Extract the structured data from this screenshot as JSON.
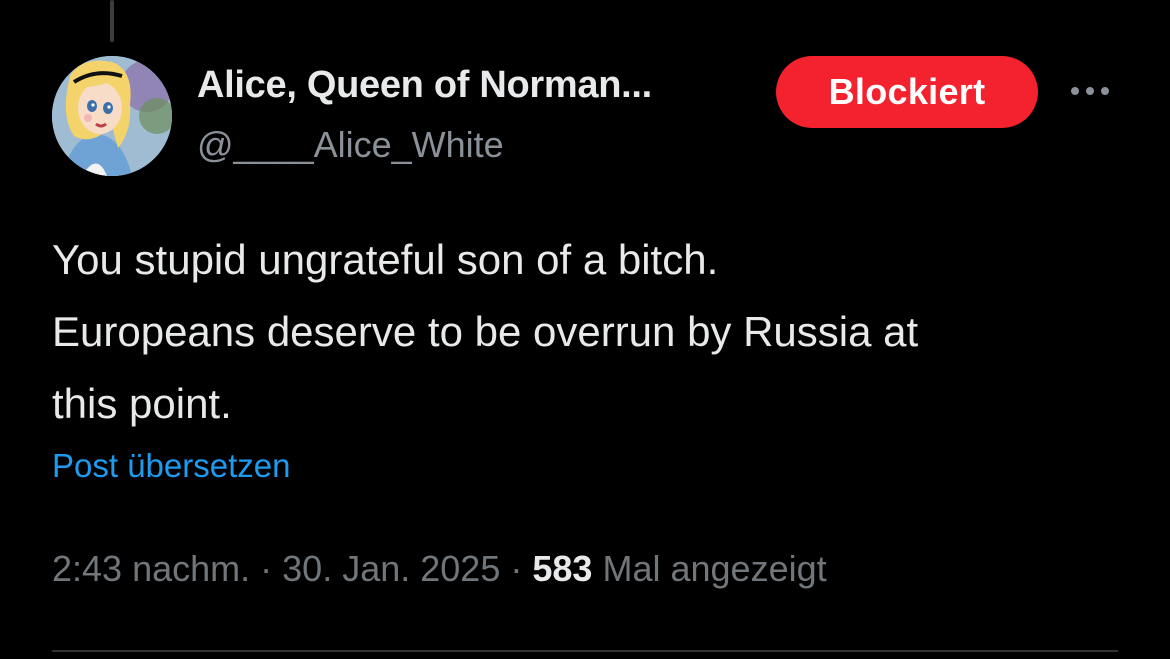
{
  "author": {
    "display_name": "Alice, Queen of Norman...",
    "handle": "@____Alice_White"
  },
  "actions": {
    "blocked_label": "Blockiert",
    "more_icon": "more-horizontal-icon"
  },
  "tweet": {
    "lines": [
      "You stupid ungrateful son of a bitch.",
      "Europeans deserve to be overrun by Russia at",
      "this point."
    ],
    "translate_label": "Post übersetzen"
  },
  "meta": {
    "time": "2:43 nachm.",
    "separator": "·",
    "date": "30. Jan. 2025",
    "views_count": "583",
    "views_label": "Mal angezeigt"
  },
  "colors": {
    "background": "#000000",
    "primary_text": "#e7e9ea",
    "secondary_text": "#71767b",
    "link": "#1d9bf0",
    "blocked": "#f4212e"
  }
}
